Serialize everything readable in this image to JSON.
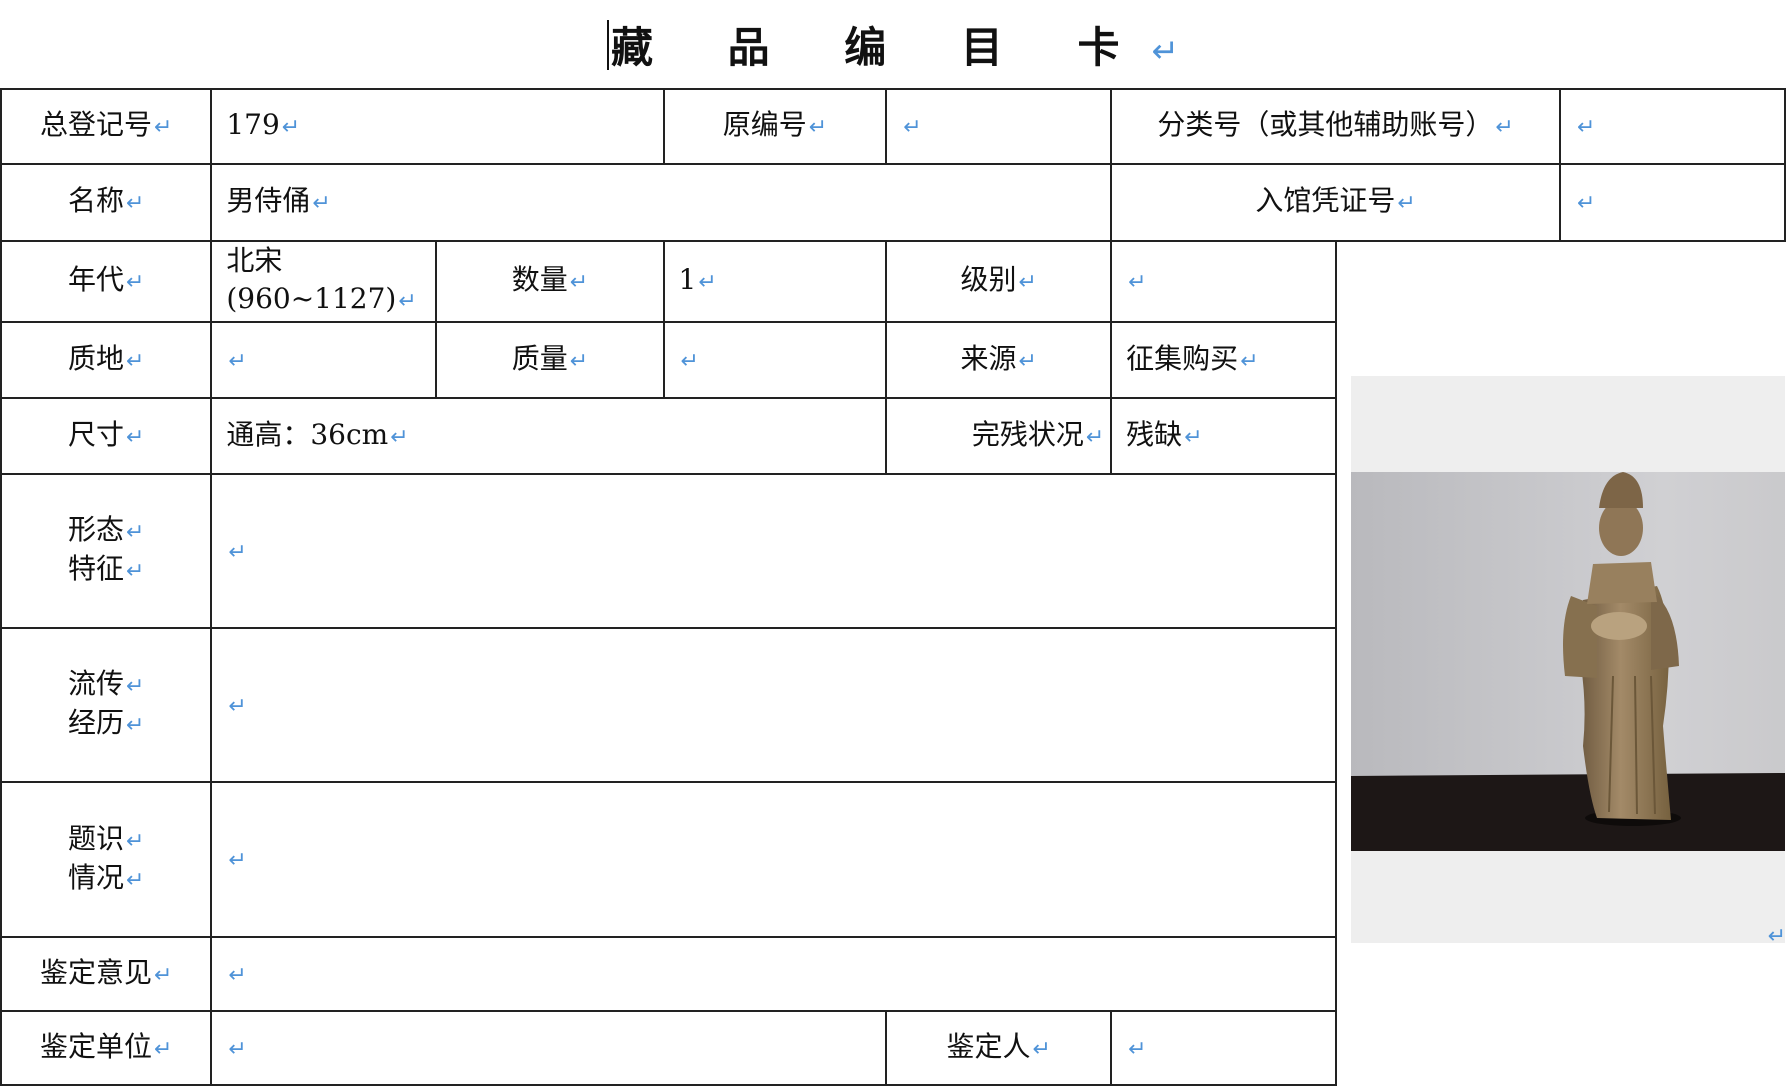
{
  "title": "藏 品 编 目 卡",
  "para_mark": "↵",
  "labels": {
    "total_reg_no": "总登记号",
    "orig_no": "原编号",
    "class_no": "分类号（或其他辅助账号）",
    "name": "名称",
    "entry_voucher": "入馆凭证号",
    "era": "年代",
    "quantity": "数量",
    "grade": "级别",
    "material": "质地",
    "mass": "质量",
    "source": "来源",
    "size": "尺寸",
    "condition": "完残状况",
    "form_line1": "形态",
    "form_line2": "特征",
    "history_line1": "流传",
    "history_line2": "经历",
    "inscription_line1": "题识",
    "inscription_line2": "情况",
    "appraisal_opinion": "鉴定意见",
    "appraisal_unit": "鉴定单位",
    "appraiser": "鉴定人"
  },
  "values": {
    "total_reg_no": "179",
    "orig_no": "",
    "class_no": "",
    "name": "男侍俑",
    "entry_voucher": "",
    "era_line1": "北宋",
    "era_line2": "(960~1127)",
    "quantity": "1",
    "grade": "",
    "material": "",
    "mass": "",
    "source": "征集购买",
    "size": "通高：36cm",
    "condition": "残缺",
    "form": "",
    "history": "",
    "inscription": "",
    "appraisal_opinion": "",
    "appraisal_unit": "",
    "appraiser": ""
  },
  "photo": {
    "subject": "standing male attendant figurine photo",
    "colors": {
      "wall": "#c9c9cc",
      "shelf": "#1d1716",
      "frame": "#3b1a14",
      "figure": "#9c8464"
    }
  }
}
